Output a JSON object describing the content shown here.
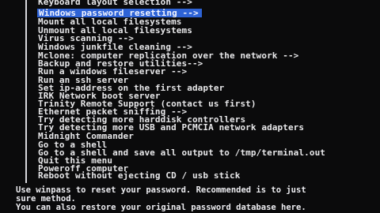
{
  "menu": {
    "items": [
      {
        "label": "Keyboard layout selection -->"
      },
      {
        "label": "Windows password resetting -->"
      },
      {
        "label": "Mount all local filesystems"
      },
      {
        "label": "Unmount all local filesystems"
      },
      {
        "label": "Virus scanning -->"
      },
      {
        "label": "Windows junkfile cleaning -->"
      },
      {
        "label": "Mclone: computer replication over the network -->"
      },
      {
        "label": "Backup and restore utilities-->"
      },
      {
        "label": "Run a windows fileserver -->"
      },
      {
        "label": "Run an ssh server"
      },
      {
        "label": "Set ip-address on the first adapter"
      },
      {
        "label": "IRK Network boot server"
      },
      {
        "label": "Trinity Remote Support (contact us first)"
      },
      {
        "label": "Ethernet packet sniffing -->"
      },
      {
        "label": "Try detecting more harddisk controllers"
      },
      {
        "label": "Try detecting more USB and PCMCIA network adapters"
      },
      {
        "label": "Midnight Commander"
      },
      {
        "label": "Go to a shell"
      },
      {
        "label": "Go to a shell and save all output to /tmp/terminal.out"
      },
      {
        "label": "Quit this menu"
      },
      {
        "label": "Poweroff computer"
      },
      {
        "label": "Reboot without ejecting CD / usb stick"
      }
    ],
    "selected_label": "Windows password resetting"
  },
  "help": {
    "line1": "Use winpass to reset your password. Recommended is to just",
    "line2": "sure method.",
    "line3": "You can also restore your original password database here."
  }
}
